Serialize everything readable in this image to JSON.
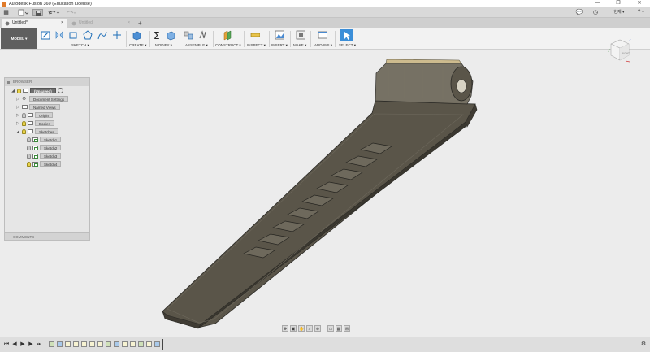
{
  "app": {
    "title": "Autodesk Fusion 360 (Education License)"
  },
  "window_controls": {
    "minimize": "—",
    "maximize": "❐",
    "close": "✕"
  },
  "quickbar": {
    "grid": "▦",
    "file_menu": "▾",
    "save": "💾",
    "undo": "↶",
    "redo": "↷",
    "chat": "💬",
    "clock": "◷",
    "user": "현재 ▾",
    "help": "? ▾"
  },
  "tabs": [
    {
      "label": "Untitled*",
      "close": "×"
    },
    {
      "label": "Untitled",
      "close": "×"
    },
    {
      "label": "+"
    }
  ],
  "toolbar": {
    "workspace": "MODEL",
    "groups": [
      "SKETCH",
      "CREATE",
      "MODIFY",
      "ASSEMBLE",
      "CONSTRUCT",
      "INSPECT",
      "INSERT",
      "MAKE",
      "ADD-INS",
      "SELECT"
    ]
  },
  "browser": {
    "title": "BROWSER",
    "root": "(Unsaved)",
    "items": [
      "Document Settings",
      "Named Views",
      "Origin",
      "Bodies",
      "Sketches"
    ],
    "sketches": [
      "Sketch1",
      "Sketch2",
      "Sketch3",
      "Sketch4"
    ]
  },
  "comments": {
    "title": "COMMENTS"
  },
  "viewcube": {
    "face_label": "RIGHT"
  },
  "colors": {
    "accent_select": "#3b8ed8",
    "model_btn": "#5f5f5f",
    "body_fill": "#5a5549"
  }
}
